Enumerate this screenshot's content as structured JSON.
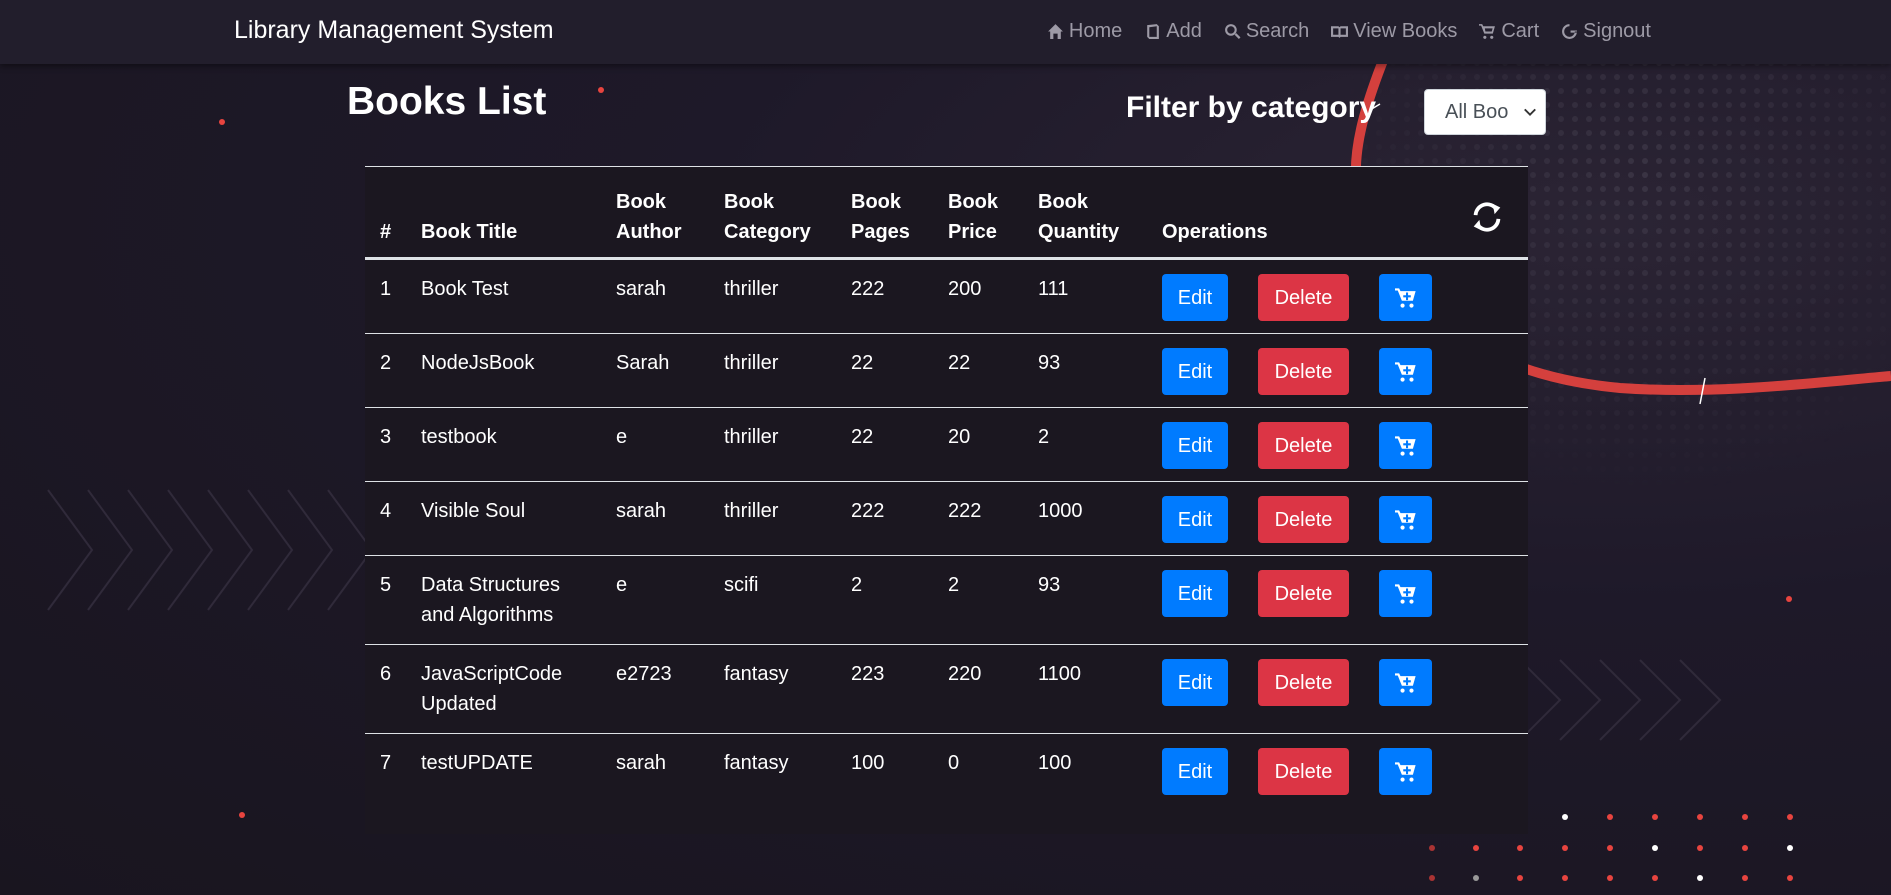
{
  "navbar": {
    "brand": "Library Management System",
    "links": [
      {
        "label": "Home",
        "icon": "home-icon"
      },
      {
        "label": "Add",
        "icon": "book-icon"
      },
      {
        "label": "Search",
        "icon": "search-icon"
      },
      {
        "label": "View Books",
        "icon": "open-book-icon"
      },
      {
        "label": "Cart",
        "icon": "cart-icon"
      },
      {
        "label": "Signout",
        "icon": "signout-icon"
      }
    ]
  },
  "page": {
    "title": "Books List",
    "filter_label": "Filter by category",
    "filter_value": "All Boo"
  },
  "table": {
    "headers": [
      "#",
      "Book Title",
      "Book Author",
      "Book Category",
      "Book Pages",
      "Book Price",
      "Book Quantity",
      "Operations"
    ],
    "refresh_icon": "refresh-icon",
    "rows": [
      [
        "1",
        "Book Test",
        "sarah",
        "thriller",
        "222",
        "200",
        "111"
      ],
      [
        "2",
        "NodeJsBook",
        "Sarah",
        "thriller",
        "22",
        "22",
        "93"
      ],
      [
        "3",
        "testbook",
        "e",
        "thriller",
        "22",
        "20",
        "2"
      ],
      [
        "4",
        "Visible Soul",
        "sarah",
        "thriller",
        "222",
        "222",
        "1000"
      ],
      [
        "5",
        "Data Structures and Algorithms",
        "e",
        "scifi",
        "2",
        "2",
        "93"
      ],
      [
        "6",
        "JavaScriptCode Updated",
        "e2723",
        "fantasy",
        "223",
        "220",
        "1100"
      ],
      [
        "7",
        "testUPDATE",
        "sarah",
        "fantasy",
        "100",
        "0",
        "100"
      ]
    ],
    "edit_label": "Edit",
    "delete_label": "Delete",
    "cart_icon": "cart-icon"
  },
  "colors": {
    "primary": "#007bff",
    "danger": "#dc3545",
    "navbar_bg": "#221e2c",
    "accent_curve": "#e8443f"
  }
}
